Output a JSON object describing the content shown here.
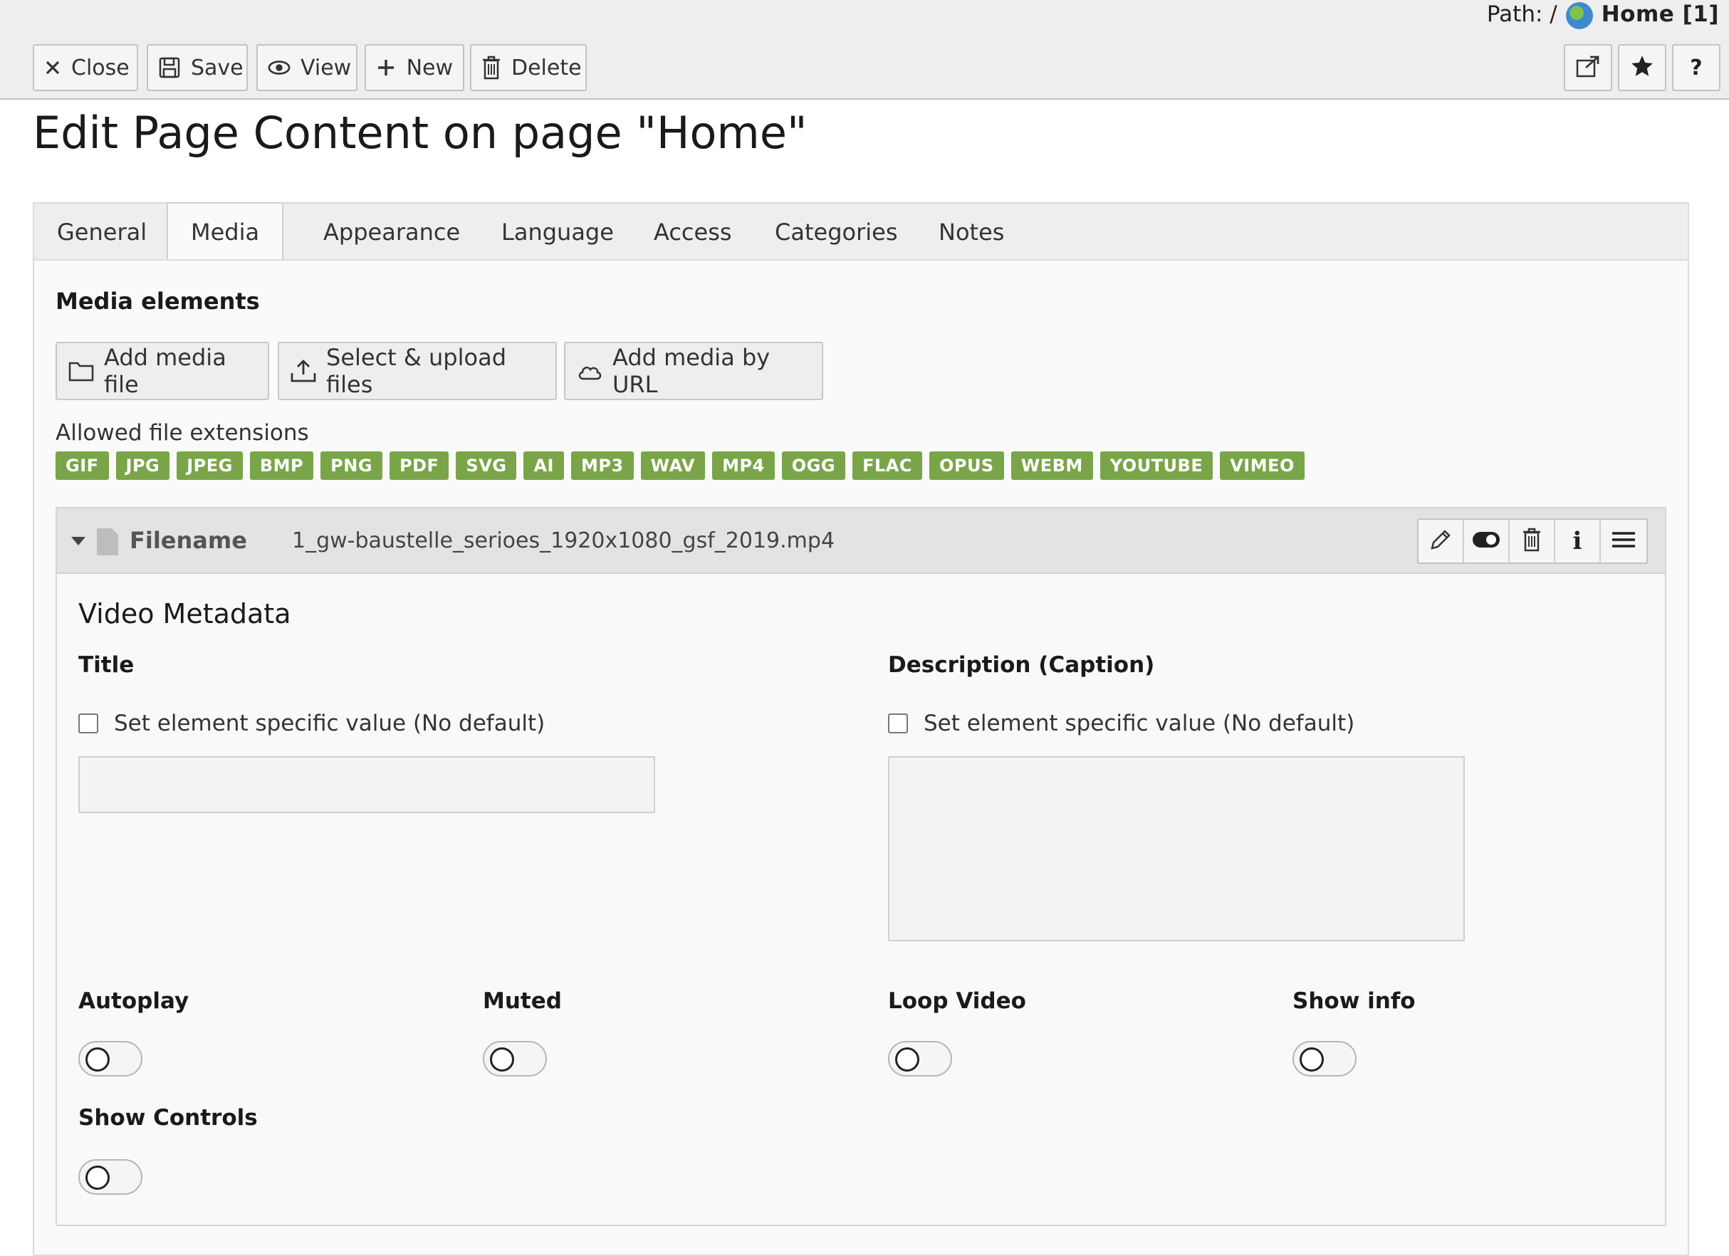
{
  "path": {
    "prefix": "Path: /",
    "page": "Home [1]"
  },
  "toolbar": {
    "close": "Close",
    "save": "Save",
    "view": "View",
    "new": "New",
    "delete": "Delete"
  },
  "page_title": "Edit Page Content on page \"Home\"",
  "tabs": [
    "General",
    "Media",
    "Appearance",
    "Language",
    "Access",
    "Categories",
    "Notes"
  ],
  "active_tab": "Media",
  "media": {
    "section_label": "Media elements",
    "buttons": {
      "add_file": "Add media file",
      "upload": "Select & upload files",
      "add_url": "Add media by URL"
    },
    "extensions_label": "Allowed file extensions",
    "extensions": [
      "GIF",
      "JPG",
      "JPEG",
      "BMP",
      "PNG",
      "PDF",
      "SVG",
      "AI",
      "MP3",
      "WAV",
      "MP4",
      "OGG",
      "FLAC",
      "OPUS",
      "WEBM",
      "YOUTUBE",
      "VIMEO"
    ],
    "badge_color": "#79a548"
  },
  "file": {
    "label": "Filename",
    "name": "1_gw-baustelle_serioes_1920x1080_gsf_2019.mp4",
    "metadata_title": "Video Metadata",
    "title_label": "Title",
    "title_check": "Set element specific value (No default)",
    "description_label": "Description (Caption)",
    "description_check": "Set element specific value (No default)",
    "autoplay": "Autoplay",
    "muted": "Muted",
    "loop": "Loop Video",
    "showinfo": "Show info",
    "controls": "Show Controls"
  }
}
